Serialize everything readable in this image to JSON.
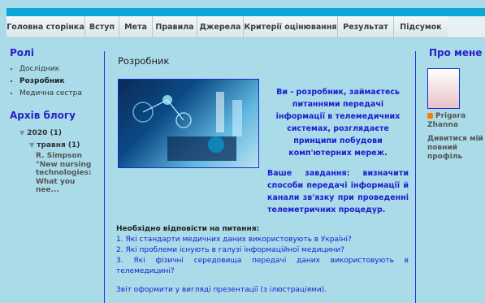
{
  "nav": {
    "items": [
      "Головна сторінка",
      "Вступ",
      "Мета",
      "Правила",
      "Джерела",
      "Критерії оцінювання",
      "Результат",
      "Підсумок"
    ]
  },
  "left": {
    "roles_title": "Ролі",
    "roles": [
      "Дослідник",
      "Розробник",
      "Медична сестра"
    ],
    "archive_title": "Архів блогу",
    "year": "2020",
    "year_count": "(1)",
    "month": "травня",
    "month_count": "(1)",
    "post_title": "R. Simpson \"New nursing technologies: What you nee..."
  },
  "main": {
    "post_heading": "Розробник",
    "intro": "Ви - розробник, займаєтесь питаннями передачі інформації в телемедичних системах, розглядаєте принципи побудови комп'ютерних мереж.",
    "task": "Ваше завдання: визначити способи передачі інформації й канали зв'язку при проведенні телеметричних процедур.",
    "questions_title": "Необхідно відповісти на питання:",
    "questions": [
      "1. Які стандарти медичних даних використовують в Україні?",
      "2. Які проблеми існують в галузі інформаційної медицини?",
      "3. Які фізичні середовища передачі даних використовують в телемедицині?"
    ],
    "report": "Звіт оформити у вигляді презентації (з ілюстраціями)."
  },
  "right": {
    "about_title": "Про мене",
    "author": "Prigara Zhanna",
    "profile_link": "Дивитися мій повний профіль"
  },
  "colors": {
    "nav_bar": "#0aa7d8",
    "background": "#a9dbe9",
    "link": "#1b1bd0"
  }
}
